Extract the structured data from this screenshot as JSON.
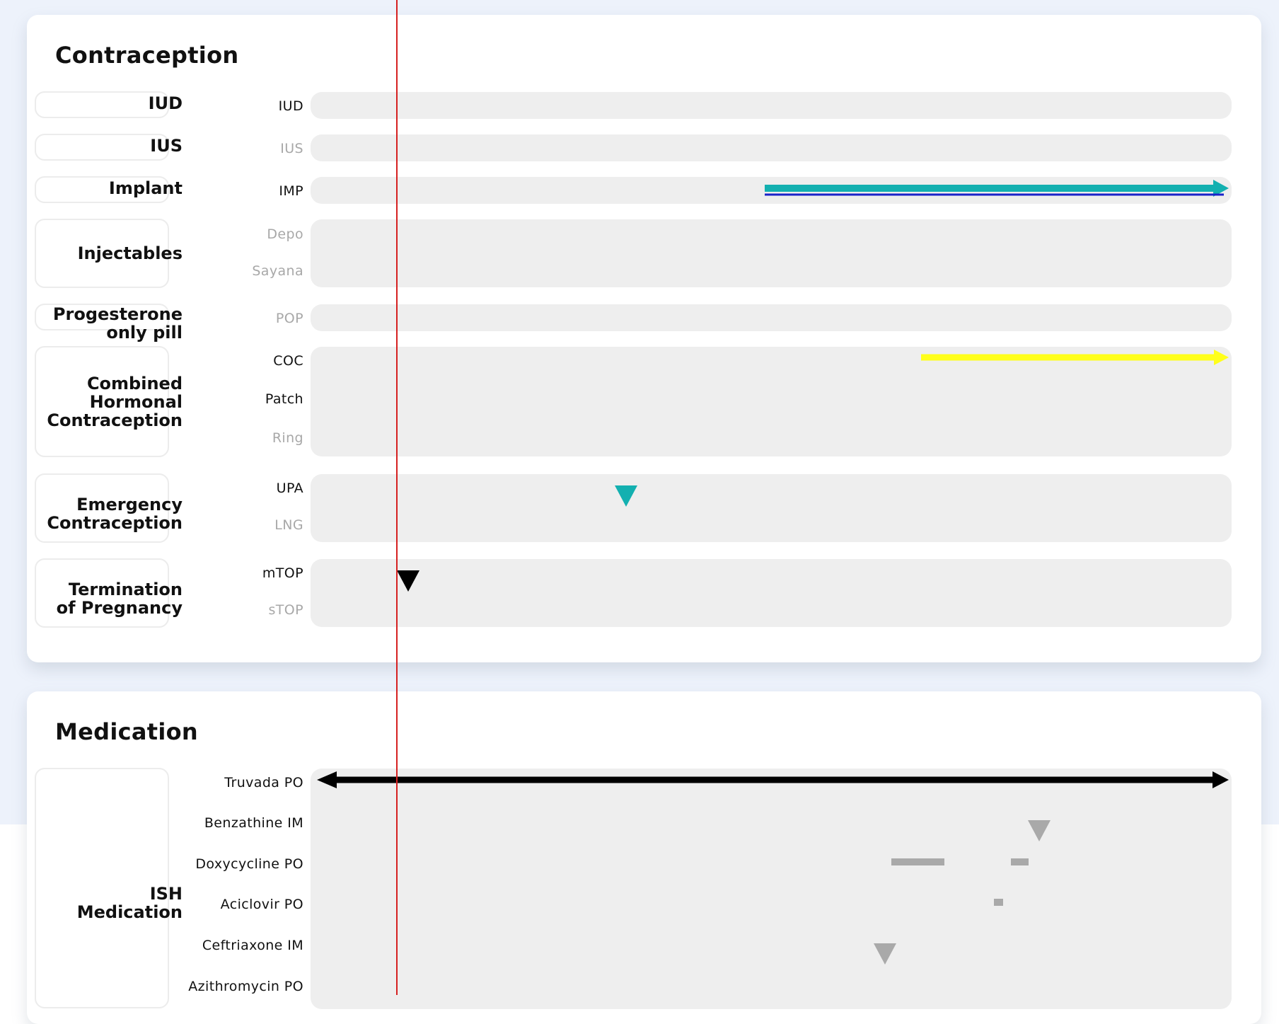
{
  "contraception": {
    "title": "Contraception",
    "groups": [
      {
        "label": "IUD",
        "rows": [
          {
            "label": "IUD",
            "active": true
          }
        ]
      },
      {
        "label": "IUS",
        "rows": [
          {
            "label": "IUS",
            "active": false
          }
        ]
      },
      {
        "label": "Implant",
        "rows": [
          {
            "label": "IMP",
            "active": true
          }
        ]
      },
      {
        "label": "Injectables",
        "rows": [
          {
            "label": "Depo",
            "active": false
          },
          {
            "label": "Sayana",
            "active": false
          }
        ]
      },
      {
        "label_lines": [
          "Progesterone",
          "only pill"
        ],
        "rows": [
          {
            "label": "POP",
            "active": false
          }
        ]
      },
      {
        "label_lines": [
          "Combined",
          "Hormonal",
          "Contraception"
        ],
        "rows": [
          {
            "label": "COC",
            "active": true
          },
          {
            "label": "Patch",
            "active": true
          },
          {
            "label": "Ring",
            "active": false
          }
        ]
      },
      {
        "label_lines": [
          "Emergency",
          "Contraception"
        ],
        "rows": [
          {
            "label": "UPA",
            "active": true
          },
          {
            "label": "LNG",
            "active": false
          }
        ]
      },
      {
        "label_lines": [
          "Termination",
          "of Pregnancy"
        ],
        "rows": [
          {
            "label": "mTOP",
            "active": true
          },
          {
            "label": "sTOP",
            "active": false
          }
        ]
      }
    ]
  },
  "medication": {
    "title": "Medication",
    "groups": [
      {
        "label_lines": [
          "ISH",
          "Medication"
        ],
        "rows": [
          {
            "label": "Truvada PO",
            "active": true
          },
          {
            "label": "Benzathine IM",
            "active": true
          },
          {
            "label": "Doxycycline PO",
            "active": true
          },
          {
            "label": "Aciclovir PO",
            "active": true
          },
          {
            "label": "Ceftriaxone IM",
            "active": true
          },
          {
            "label": "Azithromycin PO",
            "active": true
          }
        ]
      }
    ]
  },
  "colors": {
    "implant_bar": "#13b0b0",
    "implant_line": "#1a23c9",
    "coc_bar": "#ffff1a",
    "upa_marker": "#13b0b0",
    "mtop_marker": "#000000",
    "truvada": "#000000",
    "medication_marker": "#a9a9a9",
    "today_line": "#d62020"
  }
}
